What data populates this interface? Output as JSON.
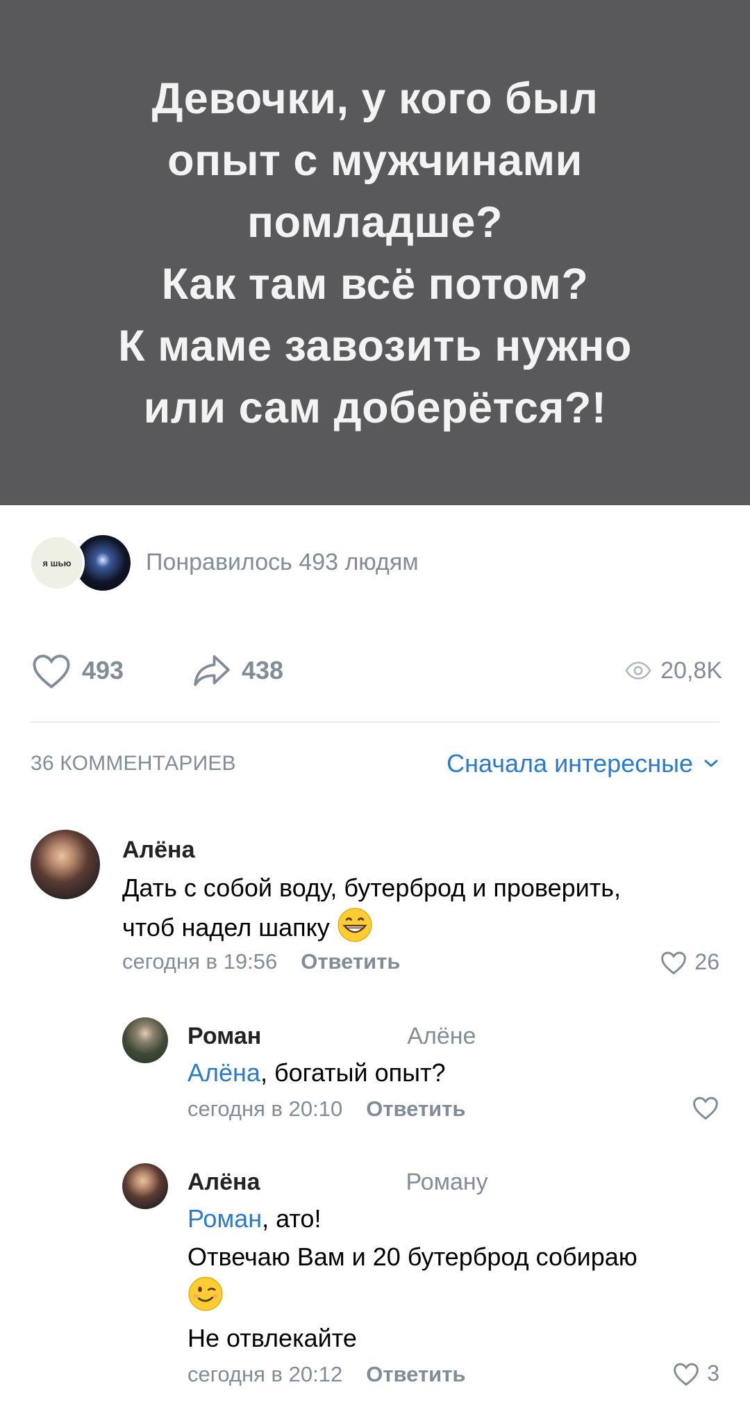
{
  "poster": {
    "text": "Девочки, у кого был\nопыт с мужчинами\nпомладше?\nКак там всё потом?\nК маме завозить нужно\nили сам доберётся?!"
  },
  "likers": {
    "avatar_text": "я шью",
    "text": "Понравилось 493 людям"
  },
  "actions": {
    "likes": "493",
    "shares": "438",
    "views": "20,8K"
  },
  "comments_header": {
    "count": "36 КОММЕНТАРИЕВ",
    "sort": "Сначала интересные"
  },
  "comments": [
    {
      "author": "Алёна",
      "text_line1": "Дать с собой воду, бутерброд и проверить,",
      "text_line2": "чтоб надел шапку",
      "time": "сегодня в 19:56",
      "reply": "Ответить",
      "likes": "26"
    },
    {
      "author": "Роман",
      "reply_to": "Алёне",
      "mention": "Алёна",
      "text": ", богатый опыт?",
      "time": "сегодня в 20:10",
      "reply": "Ответить",
      "likes": ""
    },
    {
      "author": "Алёна",
      "reply_to": "Роману",
      "mention": "Роман",
      "text_line1": ", ато!",
      "text_line2": "Отвечаю Вам и 20 бутерброд собираю",
      "text_line3": "Не отвлекайте",
      "time": "сегодня в 20:12",
      "reply": "Ответить",
      "likes": "3"
    }
  ],
  "colors": {
    "poster_bg": "#59595b",
    "accent": "#2a7bd0",
    "secondary_text": "#818c99"
  }
}
